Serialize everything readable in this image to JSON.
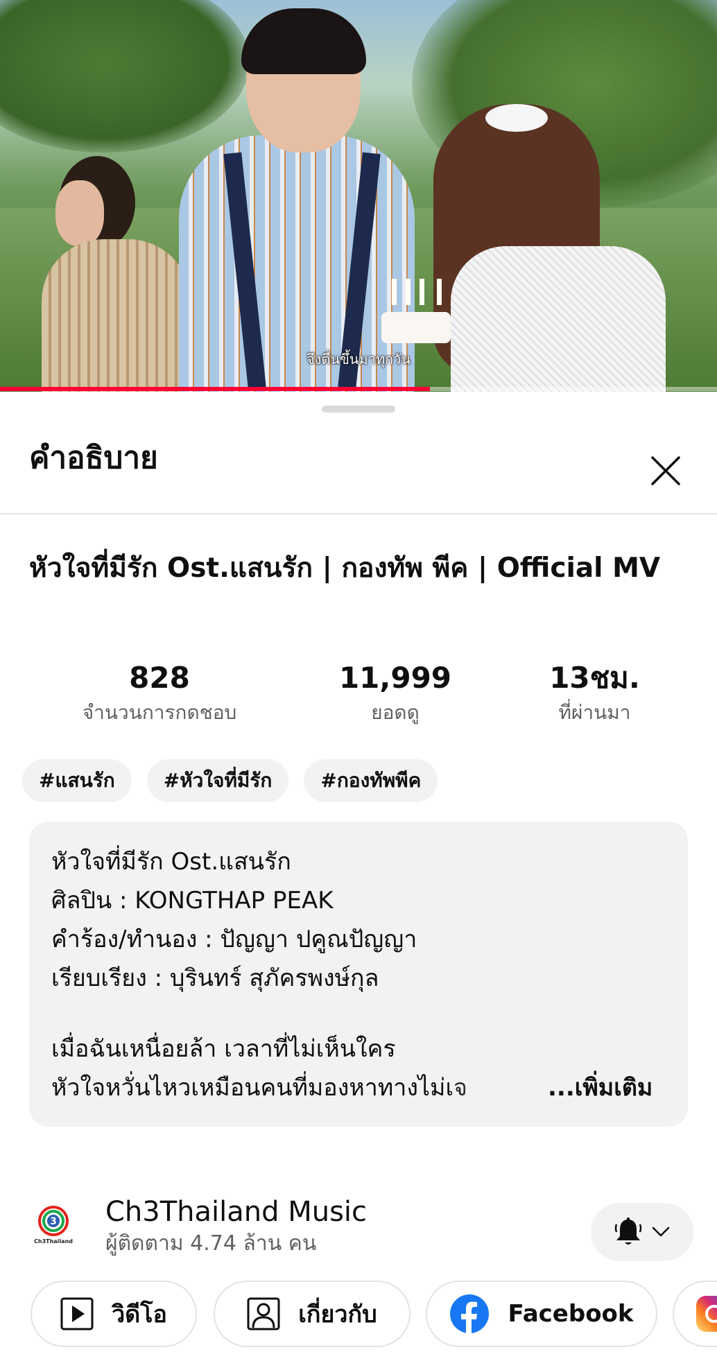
{
  "video": {
    "subtitle": "จึงตื่นขึ้นมาทุกวัน",
    "progress_fraction": 0.6
  },
  "sheet": {
    "title": "คำอธิบาย",
    "close_icon": "close-icon"
  },
  "video_title": "หัวใจที่มีรัก Ost.แสนรัก | กองทัพ พีค | Official MV",
  "stats": [
    {
      "value": "828",
      "label": "จำนวนการกดชอบ"
    },
    {
      "value": "11,999",
      "label": "ยอดดู"
    },
    {
      "value": "13ชม.",
      "label": "ที่ผ่านมา"
    }
  ],
  "tags": [
    "#แสนรัก",
    "#หัวใจที่มีรัก",
    "#กองทัพพีค"
  ],
  "description": {
    "lines": [
      "หัวใจที่มีรัก Ost.แสนรัก",
      "ศิลปิน :  KONGTHAP PEAK",
      "คำร้อง/ทำนอง : ปัญญา ปคูณปัญญา",
      "เรียบเรียง : บุรินทร์  สุภัครพงษ์กุล"
    ],
    "lyrics": [
      "เมื่อฉันเหนื่อยล้า เวลาที่ไม่เห็นใคร",
      "หัวใจหวั่นไหวเหมือนคนที่มองหาทางไม่เจ"
    ],
    "more_label": "...เพิ่มเติม"
  },
  "channel": {
    "name": "Ch3Thailand Music",
    "subscribers": "ผู้ติดตาม 4.74 ล้าน คน",
    "logo_text": "Ch3Thailand",
    "logo_number": "3"
  },
  "links": [
    {
      "label": "วิดีโอ",
      "icon": "play-icon"
    },
    {
      "label": "เกี่ยวกับ",
      "icon": "person-icon"
    },
    {
      "label": "Facebook",
      "icon": "facebook-icon"
    },
    {
      "label": "",
      "icon": "instagram-icon"
    }
  ],
  "colors": {
    "progress": "#ff0033",
    "facebook": "#1877f2",
    "chip_bg": "#f2f2f2",
    "secondary_text": "#606060"
  }
}
